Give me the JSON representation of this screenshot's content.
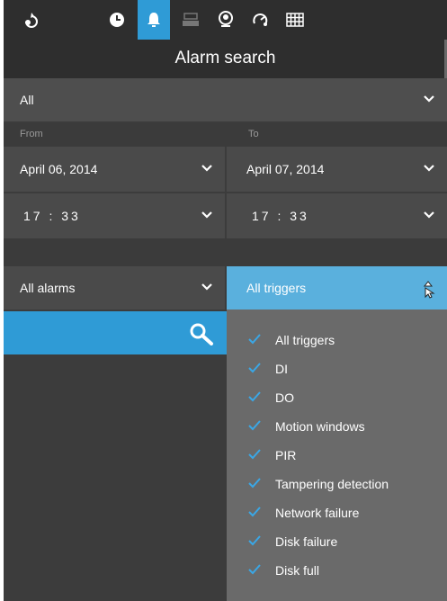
{
  "toolbar": {
    "icons": [
      "rotate-icon",
      "history-icon",
      "alarm-bell-icon",
      "storage-icon",
      "face-search-icon",
      "dashboard-icon",
      "grid-icon"
    ],
    "active": "alarm-bell-icon",
    "accent": "#2f9bd6"
  },
  "title": "Alarm search",
  "camera_select": {
    "value": "All"
  },
  "labels": {
    "from": "From",
    "to": "To"
  },
  "from": {
    "date": "April 06, 2014",
    "time": "17 : 33"
  },
  "to": {
    "date": "April 07, 2014",
    "time": "17 : 33"
  },
  "alarm_select": {
    "value": "All alarms"
  },
  "trigger_select": {
    "value": "All triggers",
    "options": [
      "All triggers",
      "DI",
      "DO",
      "Motion windows",
      "PIR",
      "Tampering detection",
      "Network failure",
      "Disk failure",
      "Disk full"
    ]
  }
}
